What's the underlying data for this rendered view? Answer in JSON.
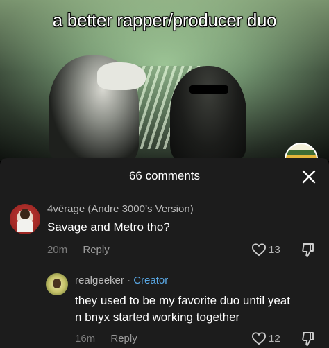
{
  "video": {
    "caption": "a better rapper/producer duo"
  },
  "sheet": {
    "comment_count": "66 comments"
  },
  "comments": [
    {
      "username": "4vërage (Andre 3000’s Version)",
      "text": "Savage and Metro tho?",
      "time": "20m",
      "reply_label": "Reply",
      "likes": "13"
    },
    {
      "username": "realgeëker",
      "separator": "·",
      "creator_badge": "Creator",
      "text": "they used to be my favorite duo until yeat n bnyx started working together",
      "time": "16m",
      "reply_label": "Reply",
      "likes": "12"
    }
  ],
  "colors": {
    "sheet_bg": "#1c1c1c",
    "creator_accent": "#5aa9e6",
    "muted_text": "#9b9b9b"
  },
  "icons": [
    "close-icon",
    "heart-icon",
    "thumbs-down-icon"
  ]
}
